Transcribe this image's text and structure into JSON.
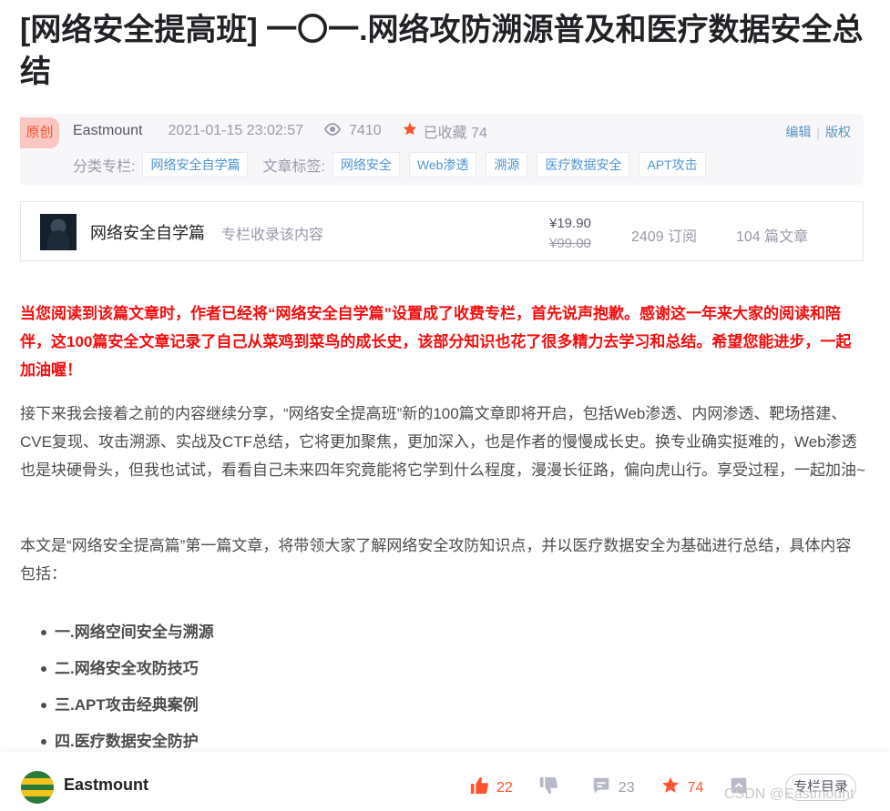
{
  "article": {
    "title": "[网络安全提高班] 一〇一.网络攻防溯源普及和医疗数据安全总结"
  },
  "meta": {
    "badge": "原创",
    "author": "Eastmount",
    "datetime": "2021-01-15 23:02:57",
    "views": "7410",
    "collect_label": "已收藏 74",
    "edit_label": "编辑",
    "copyright_label": "版权",
    "category_label": "分类专栏:",
    "categories": [
      "网络安全自学篇"
    ],
    "tags_label": "文章标签:",
    "tags": [
      "网络安全",
      "Web渗透",
      "溯源",
      "医疗数据安全",
      "APT攻击"
    ]
  },
  "column": {
    "name": "网络安全自学篇",
    "desc": "专栏收录该内容",
    "price": "¥19.90",
    "original_price": "¥99.00",
    "subscribers": "2409 订阅",
    "articles": "104 篇文章"
  },
  "body": {
    "notice": "当您阅读到该篇文章时，作者已经将“网络安全自学篇”设置成了收费专栏，首先说声抱歉。感谢这一年来大家的阅读和陪伴，这100篇安全文章记录了自己从菜鸡到菜鸟的成长史，该部分知识也花了很多精力去学习和总结。希望您能进步，一起加油喔！",
    "para1": "接下来我会接着之前的内容继续分享，“网络安全提高班”新的100篇文章即将开启，包括Web渗透、内网渗透、靶场搭建、CVE复现、攻击溯源、实战及CTF总结，它将更加聚焦，更加深入，也是作者的慢慢成长史。换专业确实挺难的，Web渗透也是块硬骨头，但我也试试，看看自己未来四年究竟能将它学到什么程度，漫漫长征路，偏向虎山行。享受过程，一起加油~",
    "para2": "本文是“网络安全提高篇”第一篇文章，将带领大家了解网络安全攻防知识点，并以医疗数据安全为基础进行总结，具体内容包括：",
    "toc": [
      "一.网络空间安全与溯源",
      "二.网络安全攻防技巧",
      "三.APT攻击经典案例",
      "四.医疗数据安全防护"
    ]
  },
  "bottom_bar": {
    "author": "Eastmount",
    "likes": "22",
    "comments": "23",
    "favorites": "74",
    "toc_button": "专栏目录",
    "watermark": "CSDN @Eastmount"
  },
  "colors": {
    "accent_red": "#fc5531",
    "notice_red": "#f40e0e",
    "link_blue": "#5094d5"
  },
  "icons": [
    "eye-icon",
    "star-icon",
    "like-icon",
    "dislike-icon",
    "comment-icon",
    "favorite-icon",
    "share-icon"
  ]
}
